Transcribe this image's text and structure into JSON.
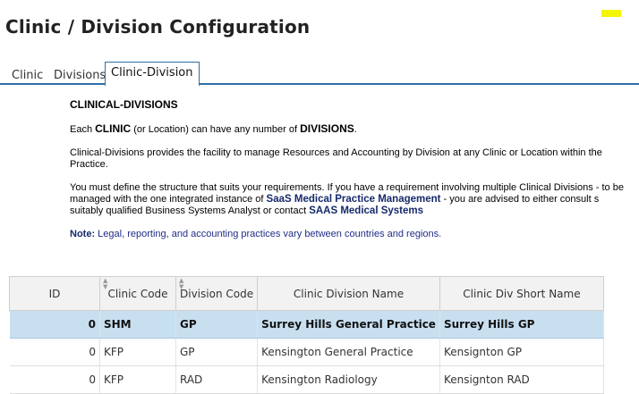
{
  "page": {
    "title": "Clinic / Division Configuration"
  },
  "tabs": [
    {
      "label": "Clinic"
    },
    {
      "label": "Divisions"
    },
    {
      "label": "Clinic-Division"
    }
  ],
  "info": {
    "heading": "CLINICAL-DIVISIONS",
    "line1_pre": "Each ",
    "line1_clinic": "CLINIC",
    "line1_mid": " (or Location) can have any number of ",
    "line1_divisions": "DIVISIONS",
    "line1_post": ".",
    "line2": "Clinical-Divisions provides the facility to manage Resources and Accounting by Division at any Clinic or Location within the Practice.",
    "para3_a": "You must define the structure that suits your requirements. If you have a requirement involving multiple Clinical Divisions - to be managed with the one integrated instance of ",
    "para3_product": "SaaS Medical Practice Management",
    "para3_b": " - you are advised to either consult s suitably qualified Business Systems Analyst or contact ",
    "para3_company": "SAAS Medical Systems",
    "note_label": "Note",
    "note_colon": ":",
    "note_text": " Legal, reporting, and accounting practices vary between countries and regions."
  },
  "grid": {
    "columns": [
      "ID",
      "Clinic Code",
      "Division Code",
      "Clinic Division Name",
      "Clinic Div Short Name"
    ],
    "rows": [
      {
        "id": "0",
        "clinic_code": "SHM",
        "division_code": "GP",
        "name": "Surrey Hills General Practice",
        "short_name": "Surrey Hills GP",
        "selected": true
      },
      {
        "id": "0",
        "clinic_code": "KFP",
        "division_code": "GP",
        "name": "Kensington General Practice",
        "short_name": "Kensignton GP",
        "selected": false
      },
      {
        "id": "0",
        "clinic_code": "KFP",
        "division_code": "RAD",
        "name": "Kensington Radiology",
        "short_name": "Kensignton RAD",
        "selected": false
      }
    ]
  },
  "colors": {
    "accent": "#2f6ea6",
    "selected_row": "#c8dff0",
    "navy_text": "#15296b",
    "marker_yellow": "#f4f500"
  }
}
